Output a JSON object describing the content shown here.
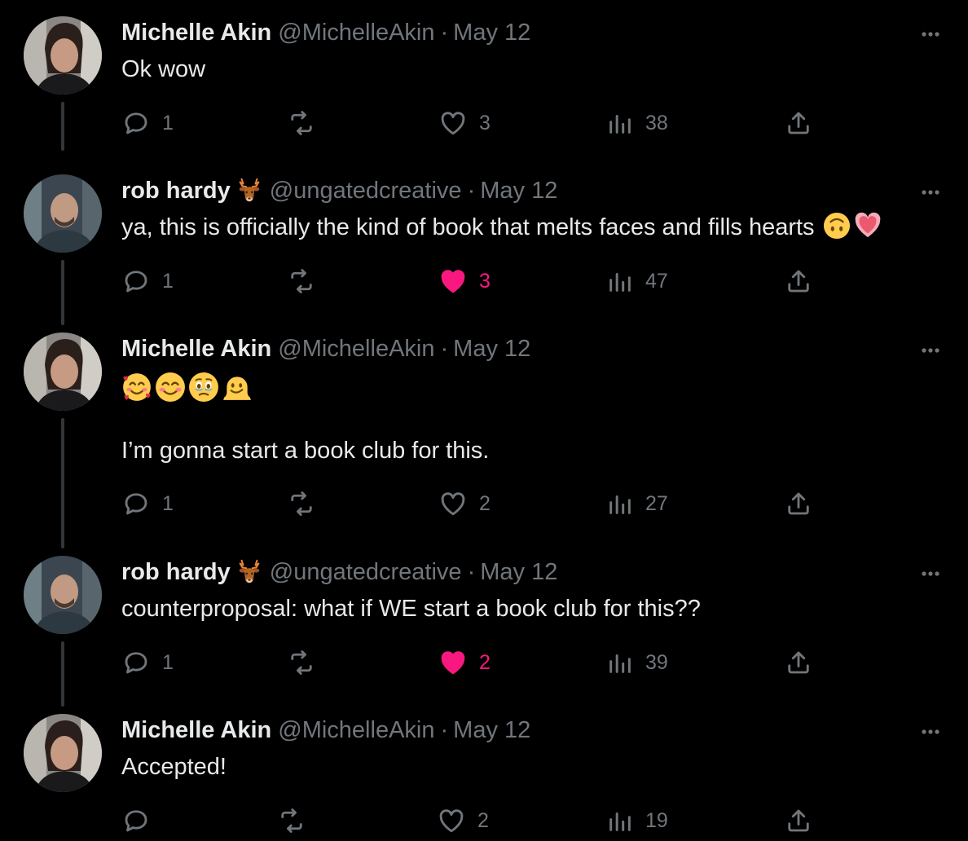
{
  "tweets": [
    {
      "name": "Michelle Akin",
      "handle": "@MichelleAkin",
      "separator": "·",
      "date": "May 12",
      "text": "Ok wow",
      "avatar": "michelle-avatar",
      "replies": "1",
      "likes": "3",
      "liked": false,
      "views": "38"
    },
    {
      "name": "rob hardy",
      "name_emoji": "deer-emoji",
      "handle": "@ungatedcreative",
      "separator": "·",
      "date": "May 12",
      "text": "ya, this is officially the kind of book that melts faces and fills hearts",
      "text_emojis": [
        "upside-down-face-emoji",
        "growing-heart-emoji"
      ],
      "avatar": "rob-avatar",
      "replies": "1",
      "likes": "3",
      "liked": true,
      "views": "47"
    },
    {
      "name": "Michelle Akin",
      "handle": "@MichelleAkin",
      "separator": "·",
      "date": "May 12",
      "emoji_line": [
        "smiling-face-with-hearts-emoji",
        "smiling-face-with-smiling-eyes-emoji",
        "face-holding-back-tears-emoji",
        "melting-face-emoji"
      ],
      "text": "I’m gonna start a book club for this.",
      "avatar": "michelle-avatar",
      "replies": "1",
      "likes": "2",
      "liked": false,
      "views": "27"
    },
    {
      "name": "rob hardy",
      "name_emoji": "deer-emoji",
      "handle": "@ungatedcreative",
      "separator": "·",
      "date": "May 12",
      "text": "counterproposal: what if WE start a book club for this??",
      "avatar": "rob-avatar",
      "replies": "1",
      "likes": "2",
      "liked": true,
      "views": "39"
    },
    {
      "name": "Michelle Akin",
      "handle": "@MichelleAkin",
      "separator": "·",
      "date": "May 12",
      "text": "Accepted!",
      "avatar": "michelle-avatar",
      "replies": "",
      "likes": "2",
      "liked": false,
      "views": "19"
    }
  ],
  "colors": {
    "background": "#000000",
    "text_primary": "#e7e9ea",
    "text_secondary": "#71767b",
    "like_active": "#f91880",
    "thread_line": "#333639"
  },
  "icons": {
    "reply": "reply-icon",
    "retweet": "retweet-icon",
    "like": "like-icon",
    "like_filled": "like-filled-icon",
    "views": "views-icon",
    "share": "share-icon",
    "more": "more-icon"
  }
}
